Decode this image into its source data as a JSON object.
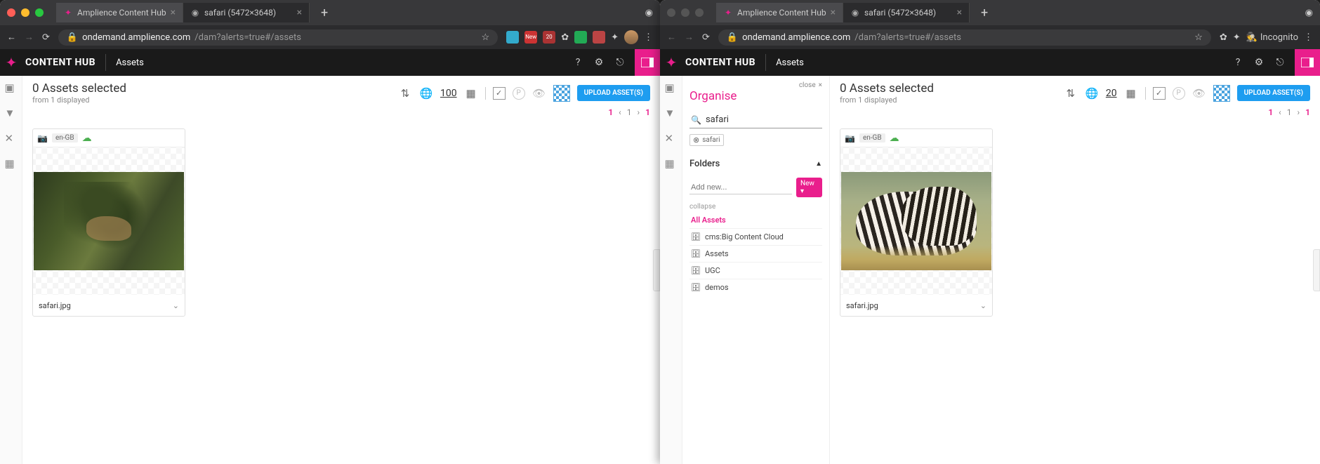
{
  "left": {
    "browser": {
      "tabs": [
        {
          "label": "Amplience Content Hub",
          "active": true
        },
        {
          "label": "safari (5472×3648)",
          "active": false
        }
      ],
      "url_domain": "ondemand.amplience.com",
      "url_path": "/dam?alerts=true#/assets"
    },
    "app": {
      "title": "CONTENT HUB",
      "nav": "Assets"
    },
    "toolbar": {
      "selected": "0 Assets selected",
      "from": "from 1 displayed",
      "count": "100",
      "upload": "UPLOAD ASSET(S)"
    },
    "pager": {
      "a": "1",
      "b": "1",
      "c": "1"
    },
    "cards": [
      {
        "locale": "en-GB",
        "filename": "safari.jpg"
      }
    ]
  },
  "right": {
    "browser": {
      "tabs": [
        {
          "label": "Amplience Content Hub",
          "active": true
        },
        {
          "label": "safari (5472×3648)",
          "active": false
        }
      ],
      "url_domain": "ondemand.amplience.com",
      "url_path": "/dam?alerts=true#/assets",
      "incognito": "Incognito"
    },
    "app": {
      "title": "CONTENT HUB",
      "nav": "Assets"
    },
    "org": {
      "close": "close",
      "title": "Organise",
      "search": "safari",
      "chip": "safari",
      "folders": "Folders",
      "add_ph": "Add new...",
      "new": "New",
      "collapse": "collapse",
      "all": "All Assets",
      "items": [
        "cms:Big Content Cloud",
        "Assets",
        "UGC",
        "demos"
      ]
    },
    "toolbar": {
      "selected": "0 Assets selected",
      "from": "from 1 displayed",
      "count": "20",
      "upload": "UPLOAD ASSET(S)"
    },
    "pager": {
      "a": "1",
      "b": "1",
      "c": "1"
    },
    "cards": [
      {
        "locale": "en-GB",
        "filename": "safari.jpg"
      }
    ]
  }
}
